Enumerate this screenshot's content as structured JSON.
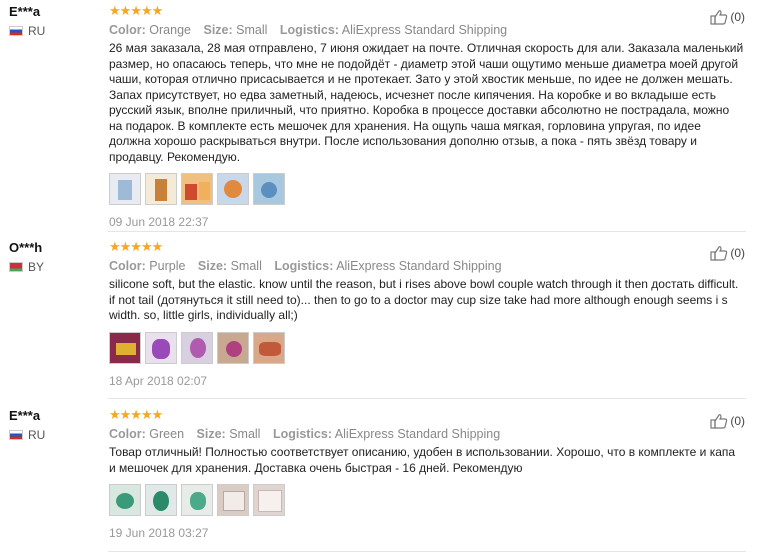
{
  "reviews": [
    {
      "user": "E***a",
      "country": "RU",
      "stars": "★★★★★",
      "color_label": "Color:",
      "color_value": "Orange",
      "size_label": "Size:",
      "size_value": "Small",
      "logistics_label": "Logistics:",
      "logistics_value": "AliExpress Standard Shipping",
      "text": "26 мая заказала, 28 мая отправлено, 7 июня ожидает на почте. Отличная скорость для али. Заказала маленький размер, но опасаюсь теперь, что мне не подойдёт - диаметр этой чаши ощутимо меньше диаметра моей другой чаши, которая отлично присасывается и не протекает. Зато у этой хвостик меньше, по идее не должен мешать. Запах присутствует, но едва заметный, надеюсь, исчезнет после кипячения. На коробке и во вкладыше есть русский язык, вполне приличный, что приятно. Коробка в процессе доставки абсолютно не пострадала, можно на подарок. В комплекте есть мешочек для хранения. На ощупь чаша мягкая, горловина упругая, по идее должна хорошо раскрываться внутри. После использования дополню отзыв, а пока - пять звёзд товару и продавцу. Рекомендую.",
      "date": "09 Jun 2018 22:37",
      "helpful": "(0)",
      "thumb_colors": [
        "#9fb9d8",
        "#c9813a",
        "#d04a2e",
        "#e08a40",
        "#5a8fc0"
      ]
    },
    {
      "user": "O***h",
      "country": "BY",
      "stars": "★★★★★",
      "color_label": "Color:",
      "color_value": "Purple",
      "size_label": "Size:",
      "size_value": "Small",
      "logistics_label": "Logistics:",
      "logistics_value": "AliExpress Standard Shipping",
      "text": "silicone soft, but the elastic. know until the reason, but i rises above bowl couple watch through it then достать difficult. if not tail (дотянуться it still need to)... then to go to a doctor may cup size take had more although enough seems i s width. so, little girls, individually all;)",
      "date": "18 Apr 2018 02:07",
      "helpful": "(0)",
      "thumb_colors": [
        "#8a2a4a",
        "#9a4ab8",
        "#b05ab0",
        "#b04080",
        "#c05a3a"
      ]
    },
    {
      "user": "E***a",
      "country": "RU",
      "stars": "★★★★★",
      "color_label": "Color:",
      "color_value": "Green",
      "size_label": "Size:",
      "size_value": "Small",
      "logistics_label": "Logistics:",
      "logistics_value": "AliExpress Standard Shipping",
      "text": "Товар отличный! Полностью соответствует описанию, удобен в использовании. Хорошо, что в комплекте и капа и мешочек для хранения. Доставка очень быстрая - 16 дней. Рекомендую",
      "date": "19 Jun 2018 03:27",
      "helpful": "(0)",
      "thumb_colors": [
        "#3a9a7a",
        "#2a8a6a",
        "#4aaa8a",
        "#d8ccc4",
        "#e0d4d0"
      ]
    }
  ]
}
